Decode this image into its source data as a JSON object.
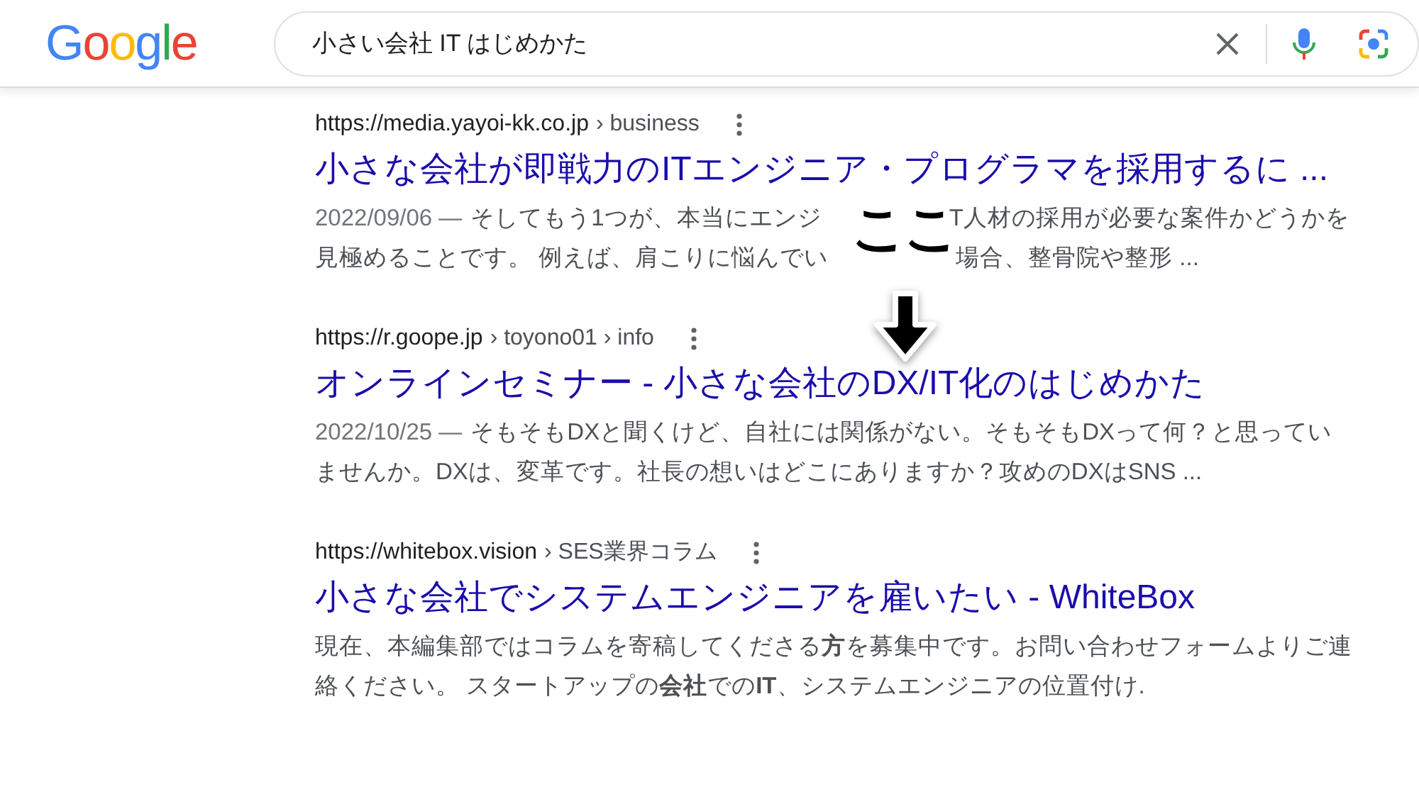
{
  "logo": "Google",
  "search": {
    "query": "小さい会社 IT はじめかた"
  },
  "annotation": {
    "text": "ここ"
  },
  "results": [
    {
      "url": "https://media.yayoi-kk.co.jp",
      "breadcrumb": "› business",
      "title": "小さな会社が即戦力のITエンジニア・プログラマを採用するに ...",
      "date": "2022/09/06 —",
      "lines": [
        [
          "そしてもう1つが、本当にエンジ",
          "T人材の採用が必要な案件かどうかを"
        ],
        [
          "見極めることです。 例えば、肩こりに悩んでい",
          "場合、整骨院や整形 ..."
        ]
      ]
    },
    {
      "url": "https://r.goope.jp",
      "breadcrumb": "› toyono01 › info",
      "title": "オンラインセミナー - 小さな会社のDX/IT化のはじめかた",
      "date": "2022/10/25 —",
      "lines": [
        [
          "そもそもDXと聞くけど、自社には関係がない。そもそもDXって何？と思ってい"
        ],
        [
          "ませんか。DXは、変革です。社長の想いはどこにありますか？攻めのDXはSNS ..."
        ]
      ]
    },
    {
      "url": "https://whitebox.vision",
      "breadcrumb": "› SES業界コラム",
      "title": "小さな会社でシステムエンジニアを雇いたい - WhiteBox",
      "lines": [
        [
          "現在、本編集部ではコラムを寄稿してくださる**方**を募集中です。お問い合わせフォームよりご連"
        ],
        [
          "絡ください。 スタートアップの**会社**での**IT**、システムエンジニアの位置付け."
        ]
      ]
    }
  ]
}
